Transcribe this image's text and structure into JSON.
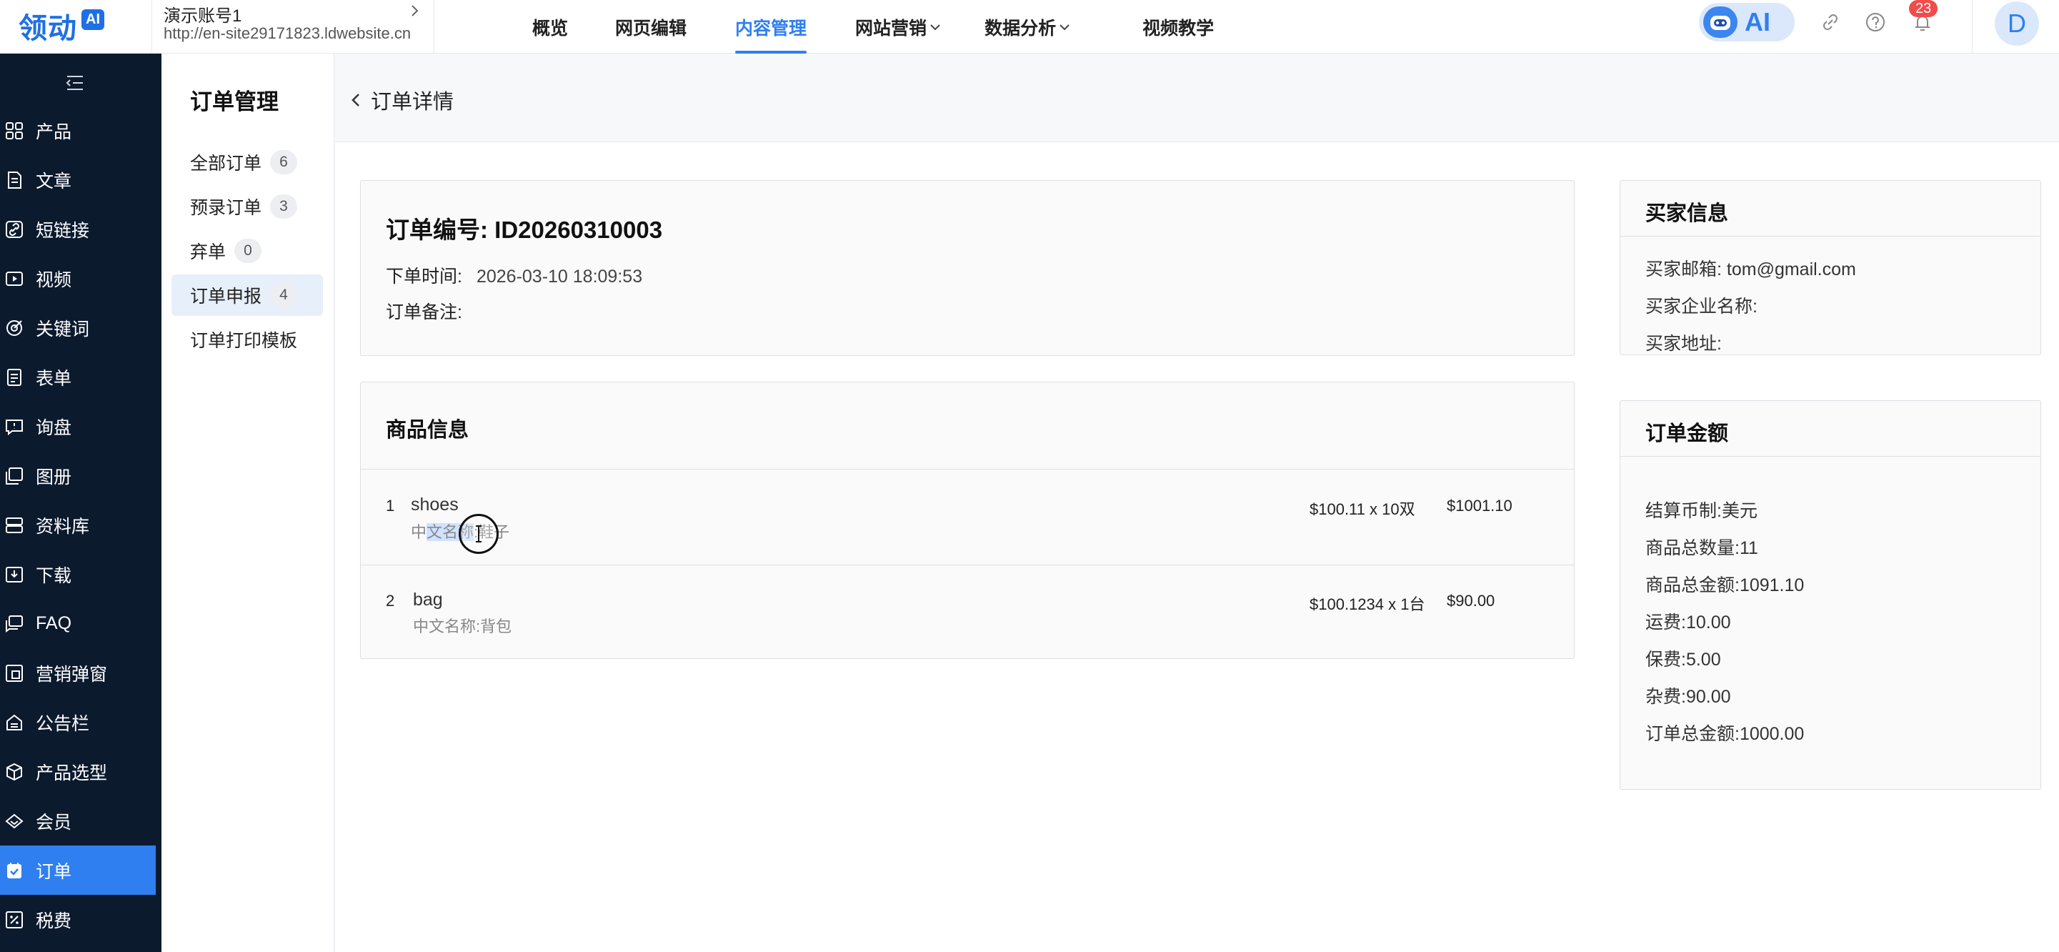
{
  "brand": {
    "logo_text": "领动",
    "logo_badge": "AI"
  },
  "site": {
    "name": "演示账号1",
    "url": "http://en-site29171823.ldwebsite.cn"
  },
  "nav": [
    {
      "label": "概览"
    },
    {
      "label": "网页编辑"
    },
    {
      "label": "内容管理",
      "active": true
    },
    {
      "label": "网站营销",
      "dropdown": true
    },
    {
      "label": "数据分析",
      "dropdown": true
    },
    {
      "label": "视频教学"
    }
  ],
  "topbar": {
    "ai_label": "AI",
    "notification_count": "23",
    "avatar_initial": "D"
  },
  "sidebar": {
    "items": [
      {
        "label": "产品",
        "icon": "grid-icon"
      },
      {
        "label": "文章",
        "icon": "document-icon"
      },
      {
        "label": "短链接",
        "icon": "link-icon"
      },
      {
        "label": "视频",
        "icon": "video-icon"
      },
      {
        "label": "关键词",
        "icon": "target-icon"
      },
      {
        "label": "表单",
        "icon": "form-icon"
      },
      {
        "label": "询盘",
        "icon": "inquiry-icon"
      },
      {
        "label": "图册",
        "icon": "album-icon"
      },
      {
        "label": "资料库",
        "icon": "database-icon"
      },
      {
        "label": "下载",
        "icon": "download-icon"
      },
      {
        "label": "FAQ",
        "icon": "faq-icon"
      },
      {
        "label": "营销弹窗",
        "icon": "popup-icon"
      },
      {
        "label": "公告栏",
        "icon": "announcement-icon"
      },
      {
        "label": "产品选型",
        "icon": "cube-icon"
      },
      {
        "label": "会员",
        "icon": "member-icon"
      },
      {
        "label": "订单",
        "icon": "order-icon",
        "active": true
      },
      {
        "label": "税费",
        "icon": "tax-icon"
      }
    ]
  },
  "subnav": {
    "title": "订单管理",
    "items": [
      {
        "label": "全部订单",
        "count": "6"
      },
      {
        "label": "预录订单",
        "count": "3"
      },
      {
        "label": "弃单",
        "count": "0"
      },
      {
        "label": "订单申报",
        "count": "4",
        "active": true
      },
      {
        "label": "订单打印模板"
      }
    ]
  },
  "page": {
    "back_label": "订单详情"
  },
  "order": {
    "number_label": "订单编号: ID20260310003",
    "time_label": "下单时间:",
    "time_value": "2026-03-10 18:09:53",
    "remark_label": "订单备注:"
  },
  "goods": {
    "title": "商品信息",
    "items": [
      {
        "index": "1",
        "name": "shoes",
        "sub_prefix": "中",
        "sub_highlight": "文名称",
        "sub_rest": ":鞋子",
        "price": "$100.11 x 10双",
        "total": "$1001.10"
      },
      {
        "index": "2",
        "name": "bag",
        "sub_prefix": "中文名称:背包",
        "sub_highlight": "",
        "sub_rest": "",
        "price": "$100.1234 x 1台",
        "total": "$90.00"
      }
    ]
  },
  "buyer": {
    "title": "买家信息",
    "email": "买家邮箱: tom@gmail.com",
    "company": "买家企业名称:",
    "address": "买家地址:"
  },
  "amount": {
    "title": "订单金额",
    "lines": [
      "结算币制:美元",
      "商品总数量:11",
      "商品总金额:1091.10",
      "运费:10.00",
      "保费:5.00",
      "杂费:90.00",
      "订单总金额:1000.00"
    ]
  },
  "colors": {
    "accent": "#2f7ff0",
    "sidebar_bg": "#0c1a2e",
    "badge": "#f14b4b"
  }
}
